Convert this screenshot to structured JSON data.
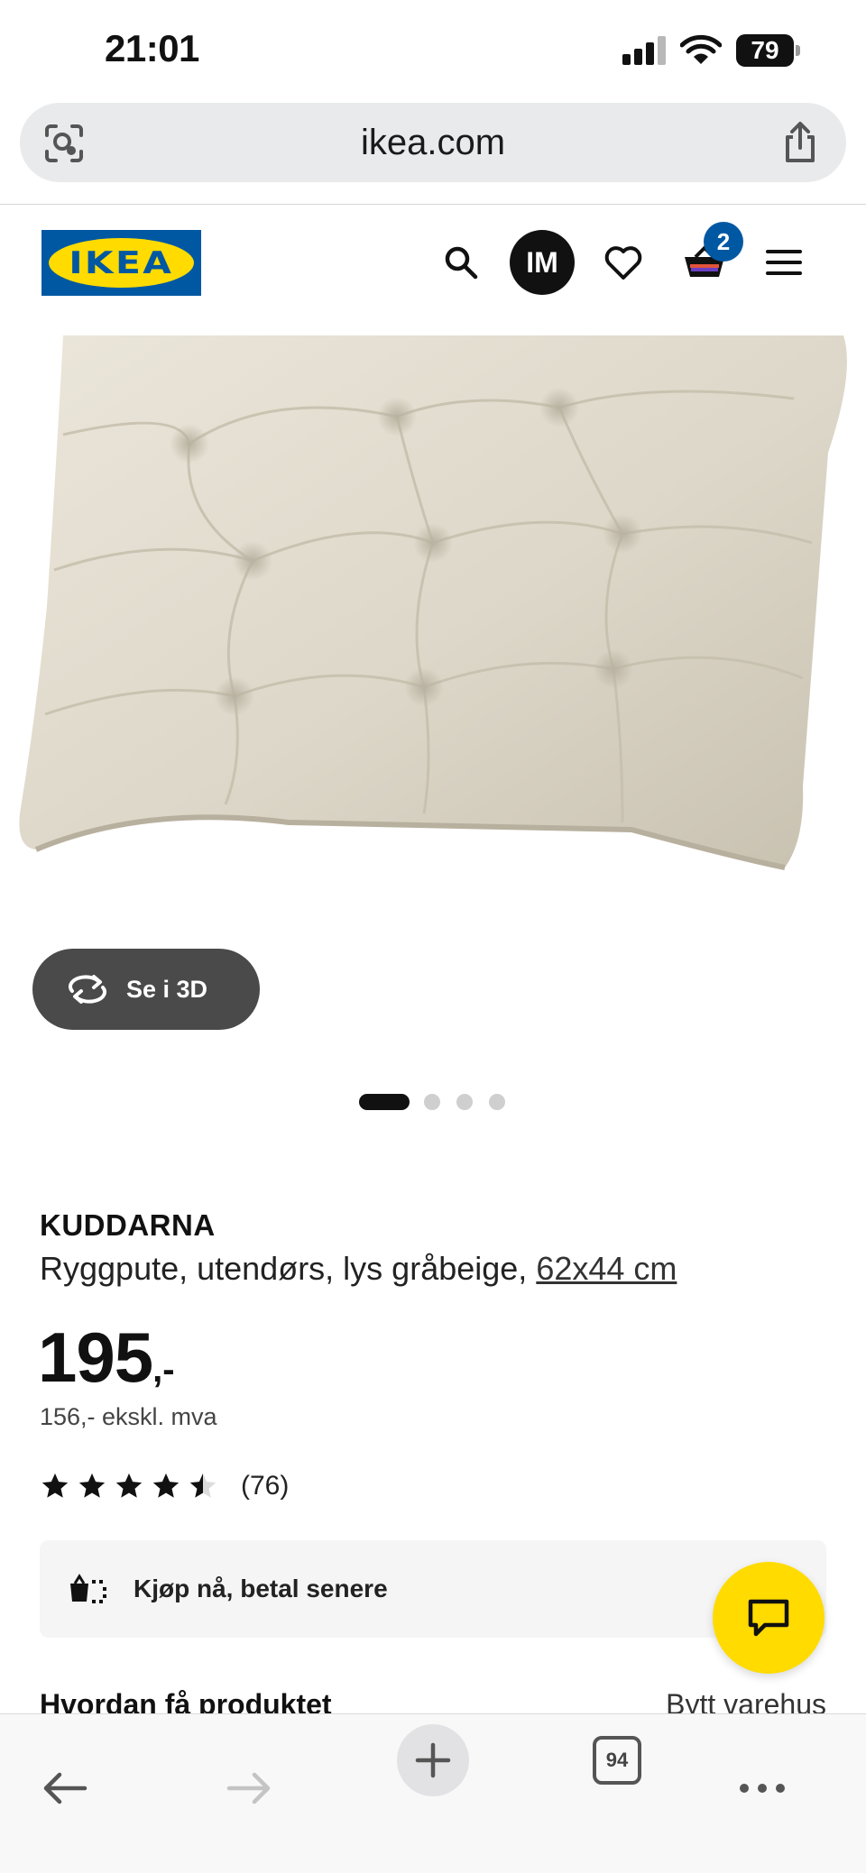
{
  "status_bar": {
    "time": "21:01",
    "battery": "79"
  },
  "browser": {
    "url": "ikea.com",
    "open_tabs": "94"
  },
  "header": {
    "logo_text": "IKEA",
    "avatar_initials": "IM",
    "cart_count": "2"
  },
  "gallery": {
    "view_3d_label": "Se i 3D",
    "image_count": 4,
    "active_index": 0
  },
  "product": {
    "name": "KUDDARNA",
    "description": "Ryggpute, utendørs, lys gråbeige, ",
    "dimensions_link": "62x44 cm",
    "price_integer": "195",
    "price_suffix": ",-",
    "price_ex_vat": "156,- ekskl. mva",
    "rating_value": 4.5,
    "rating_count": "(76)"
  },
  "bnpl": {
    "label": "Kjøp nå, betal senere"
  },
  "delivery": {
    "heading": "Hvordan få produktet",
    "change_store": "Bytt varehus"
  },
  "colors": {
    "ikea_blue": "#0058a3",
    "ikea_yellow": "#ffdb00",
    "text": "#111111",
    "card_bg": "#f5f5f5"
  }
}
